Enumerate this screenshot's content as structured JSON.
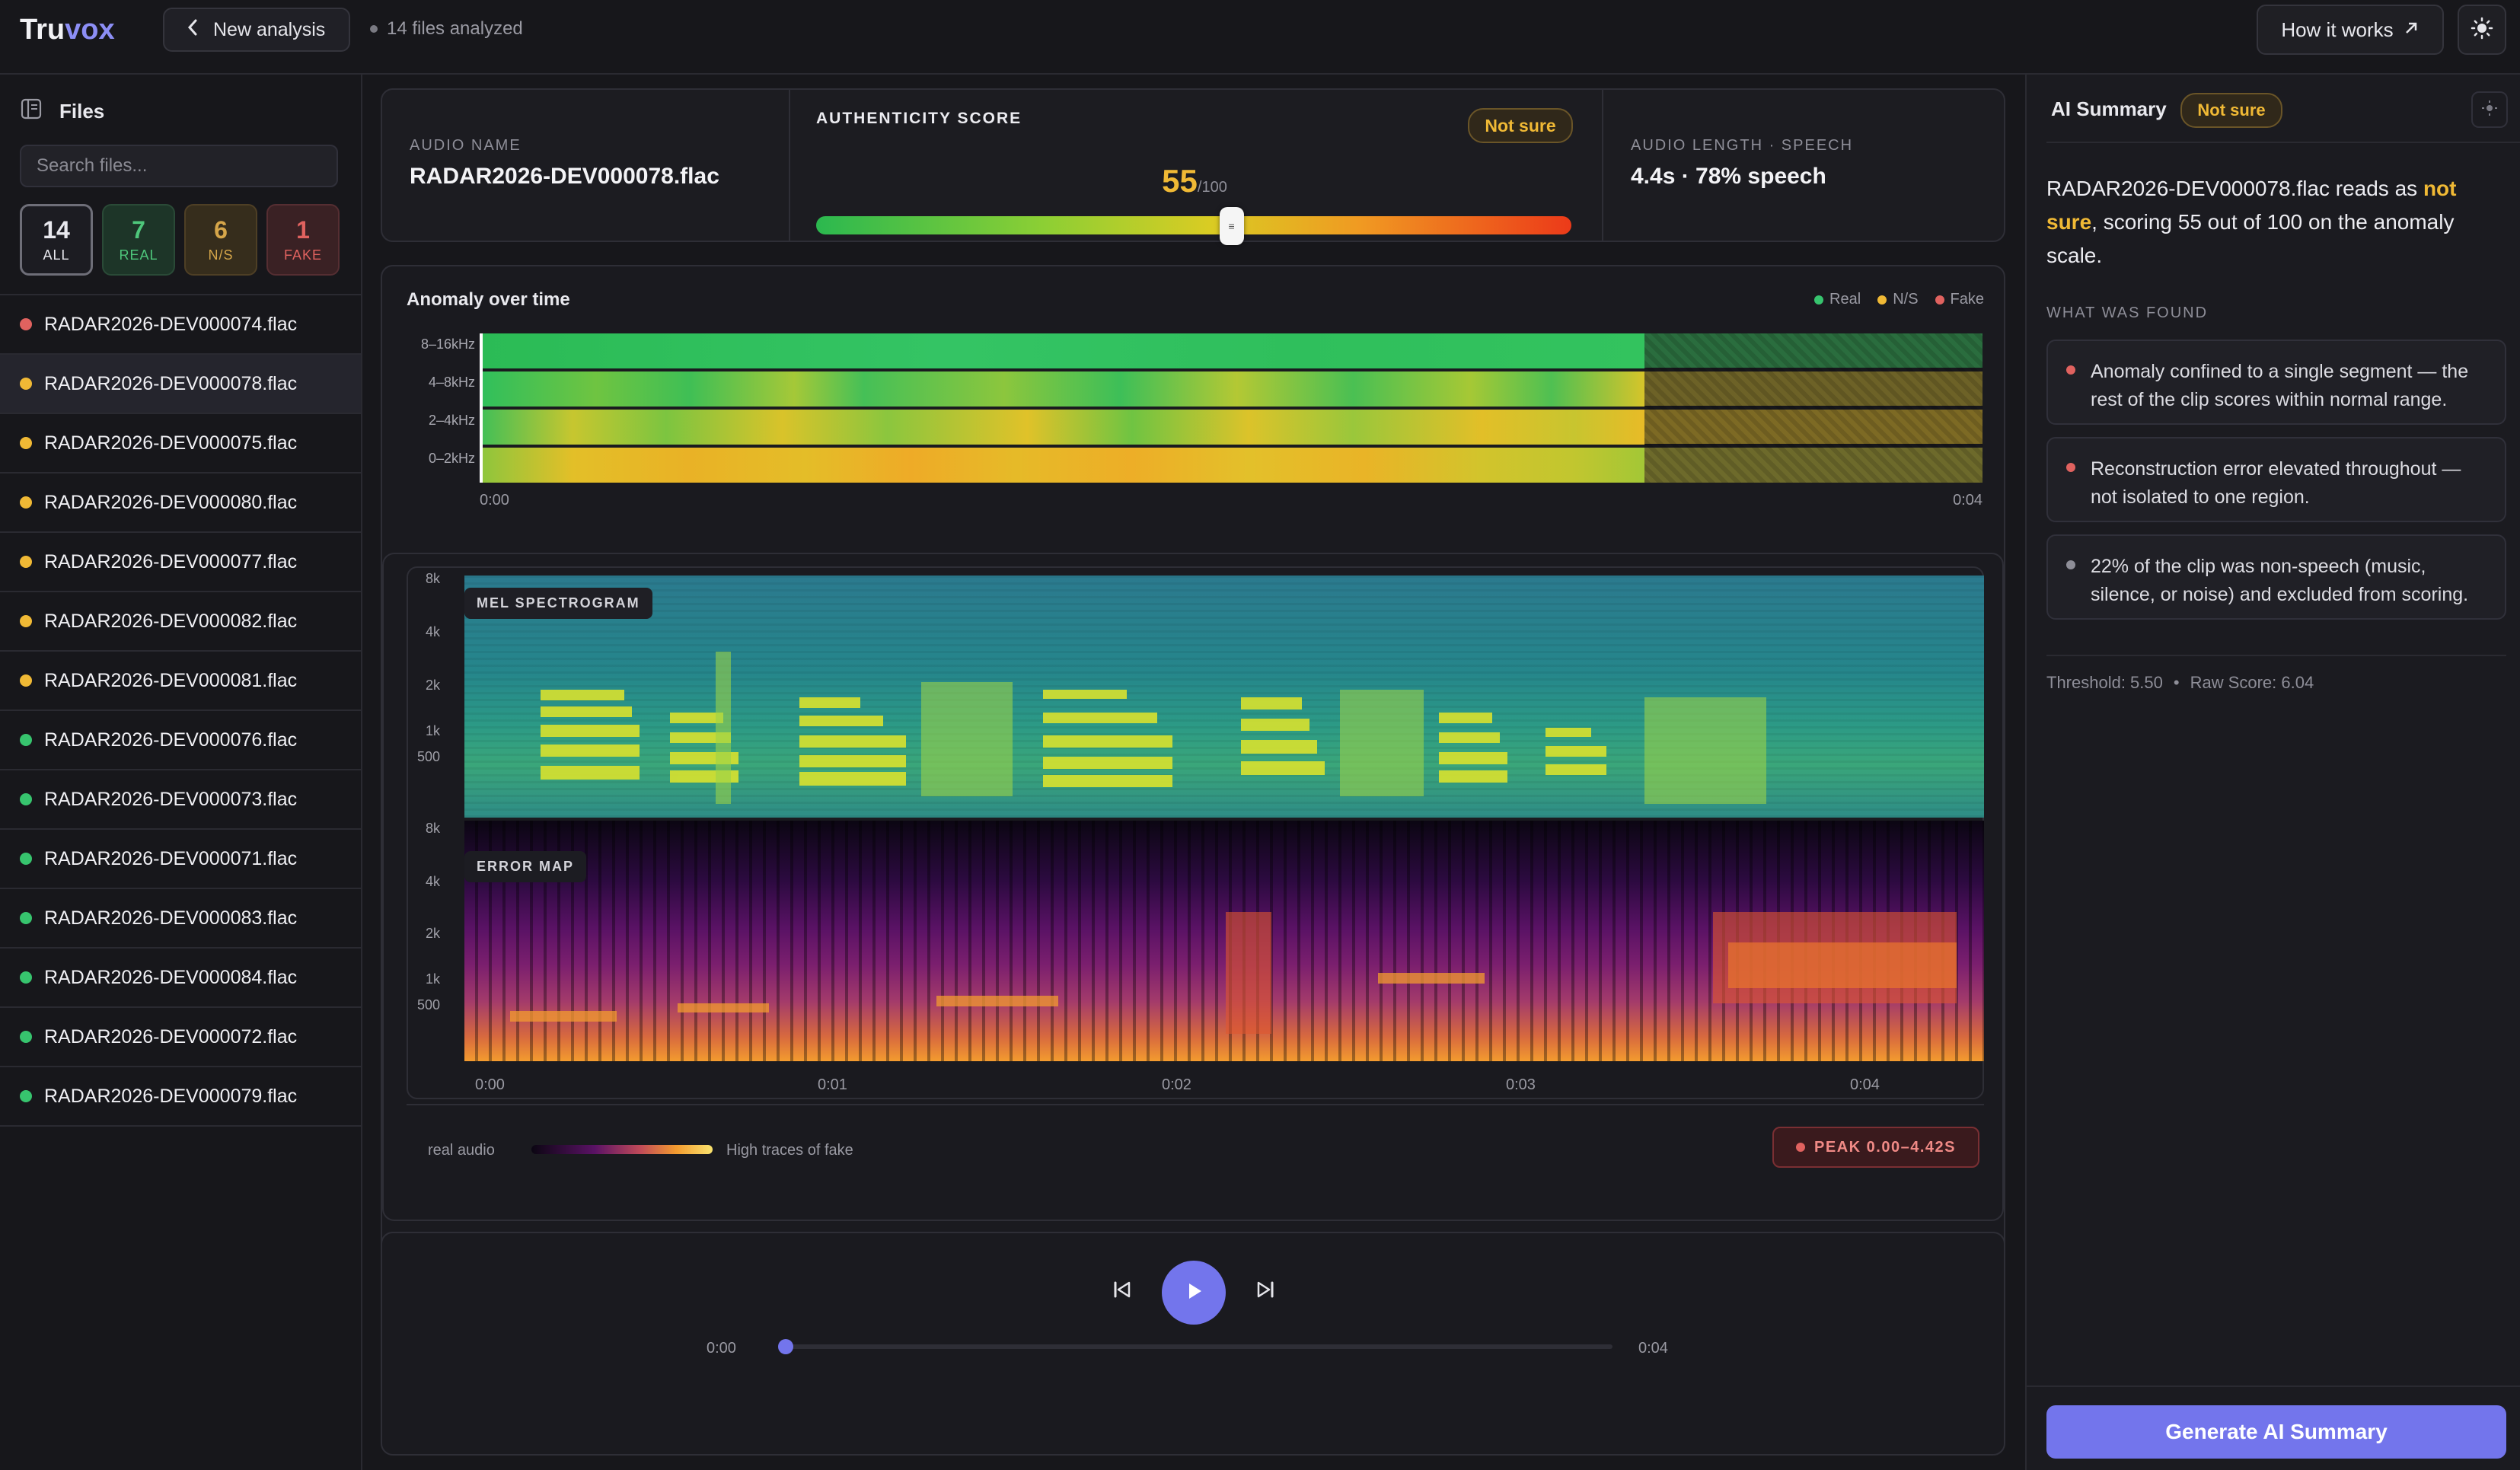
{
  "app": {
    "logo_a": "Tru",
    "logo_b": "vox",
    "new_analysis": "New analysis",
    "files_analyzed": "14 files analyzed",
    "how_it_works": "How it works",
    "theme_icon": "sun-icon"
  },
  "sidebar": {
    "title": "Files",
    "search_placeholder": "Search files...",
    "chips": [
      {
        "count": "14",
        "label": "ALL"
      },
      {
        "count": "7",
        "label": "REAL"
      },
      {
        "count": "6",
        "label": "N/S"
      },
      {
        "count": "1",
        "label": "FAKE"
      }
    ],
    "files": [
      {
        "name": "RADAR2026-DEV000074.flac",
        "status": "fake",
        "color": "#e0625f"
      },
      {
        "name": "RADAR2026-DEV000078.flac",
        "status": "ns",
        "color": "#f0b935"
      },
      {
        "name": "RADAR2026-DEV000075.flac",
        "status": "ns",
        "color": "#f0b935"
      },
      {
        "name": "RADAR2026-DEV000080.flac",
        "status": "ns",
        "color": "#f0b935"
      },
      {
        "name": "RADAR2026-DEV000077.flac",
        "status": "ns",
        "color": "#f0b935"
      },
      {
        "name": "RADAR2026-DEV000082.flac",
        "status": "ns",
        "color": "#f0b935"
      },
      {
        "name": "RADAR2026-DEV000081.flac",
        "status": "ns",
        "color": "#f0b935"
      },
      {
        "name": "RADAR2026-DEV000076.flac",
        "status": "real",
        "color": "#37c46e"
      },
      {
        "name": "RADAR2026-DEV000073.flac",
        "status": "real",
        "color": "#37c46e"
      },
      {
        "name": "RADAR2026-DEV000071.flac",
        "status": "real",
        "color": "#37c46e"
      },
      {
        "name": "RADAR2026-DEV000083.flac",
        "status": "real",
        "color": "#37c46e"
      },
      {
        "name": "RADAR2026-DEV000084.flac",
        "status": "real",
        "color": "#37c46e"
      },
      {
        "name": "RADAR2026-DEV000072.flac",
        "status": "real",
        "color": "#37c46e"
      },
      {
        "name": "RADAR2026-DEV000079.flac",
        "status": "real",
        "color": "#37c46e"
      }
    ]
  },
  "stats": {
    "audio_name_label": "AUDIO NAME",
    "audio_name": "RADAR2026-DEV000078.flac",
    "score_label": "AUTHENTICITY SCORE",
    "score_badge": "Not sure",
    "score": "55",
    "score_max": "/100",
    "score_fraction": 0.55,
    "length_label": "AUDIO LENGTH · SPEECH",
    "length": "4.4s · 78% speech"
  },
  "anomaly": {
    "title": "Anomaly over time",
    "legend": [
      {
        "label": "Real",
        "color": "#37c46e"
      },
      {
        "label": "N/S",
        "color": "#f0b935"
      },
      {
        "label": "Fake",
        "color": "#e0625f"
      }
    ],
    "bands": [
      "8–16kHz",
      "4–8kHz",
      "2–4kHz",
      "0–2kHz"
    ],
    "start": "0:00",
    "end": "0:04"
  },
  "spectro": {
    "mel_label": "MEL SPECTROGRAM",
    "error_label": "ERROR MAP",
    "freq_ticks": [
      "8k",
      "4k",
      "2k",
      "1k",
      "500"
    ],
    "time_ticks": [
      "0:00",
      "0:01",
      "0:02",
      "0:03",
      "0:04"
    ],
    "legend_left": "real audio",
    "legend_right": "High traces of fake",
    "peak": "PEAK 0.00–4.42S"
  },
  "player": {
    "current": "0:00",
    "total": "0:04",
    "progress": 0
  },
  "summary": {
    "title": "AI Summary",
    "badge": "Not sure",
    "text_a": "RADAR2026-DEV000078.flac reads as ",
    "text_hl": "not sure",
    "text_b": ", scoring 55 out of 100 on the anomaly scale.",
    "found_label": "WHAT WAS FOUND",
    "findings": [
      {
        "text": "Anomaly confined to a single segment — the rest of the clip scores within normal range.",
        "color": "#e0625f"
      },
      {
        "text": "Reconstruction error elevated throughout — not isolated to one region.",
        "color": "#e0625f"
      },
      {
        "text": "22% of the clip was non-speech (music, silence, or noise) and excluded from scoring.",
        "color": "#8e8e98"
      }
    ],
    "threshold": "Threshold: 5.50",
    "sep": "•",
    "raw_score": "Raw Score: 6.04",
    "generate": "Generate AI Summary"
  }
}
